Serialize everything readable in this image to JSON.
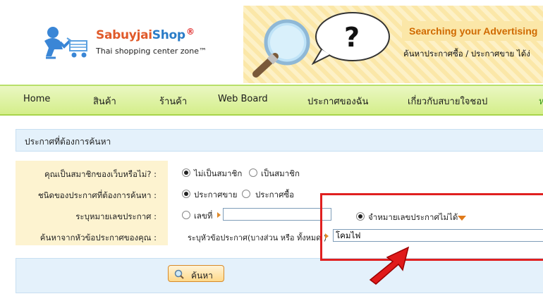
{
  "logo": {
    "name_part1": "Sabuyjai",
    "name_part2": "Shop",
    "registered": "®",
    "tagline": "Thai shopping center zone™"
  },
  "banner": {
    "title": "Searching your Advertising",
    "subtitle": "ค้นหาประกาศซื้อ / ประกาศขาย  ได้ง่"
  },
  "nav": {
    "items": [
      {
        "label": "Home"
      },
      {
        "label": "สินค้า"
      },
      {
        "label": "ร้านค้า"
      },
      {
        "label": "Web Board"
      },
      {
        "label": "ประกาศของฉัน"
      },
      {
        "label": "เกี่ยวกับสบายใจชอป"
      },
      {
        "label": "ห"
      }
    ]
  },
  "form": {
    "section_title": "ประกาศที่ต้องการค้นหา",
    "member_label": "คุณเป็นสมาชิกของเว็บหรือไม่? :",
    "member_options": [
      "ไม่เป็นสมาชิก",
      "เป็นสมาชิก"
    ],
    "member_selected": "ไม่เป็นสมาชิก",
    "type_label": "ชนิดของประกาศที่ต้องการค้นหา :",
    "type_options": [
      "ประกาศขาย",
      "ประกาศซื้อ"
    ],
    "type_selected": "ประกาศขาย",
    "number_label": "ระบุหมายเลขประกาศ :",
    "number_option": "เลขที่",
    "number_value": "",
    "forgot_option": "จำหมายเลขประกาศไม่ได้",
    "topic_label": "ค้นหาจากหัวข้อประกาศของคุณ :",
    "topic_hint": "ระบุหัวข้อประกาศ(บางส่วน หรือ ทั้งหมด )",
    "topic_value": "โคมไฟ",
    "search_button": "ค้นหา"
  },
  "colors": {
    "nav_bg": "#d4ee8a",
    "section_bg": "#e4f1fb",
    "label_bg": "#fdf3d0",
    "highlight": "#e02020"
  }
}
